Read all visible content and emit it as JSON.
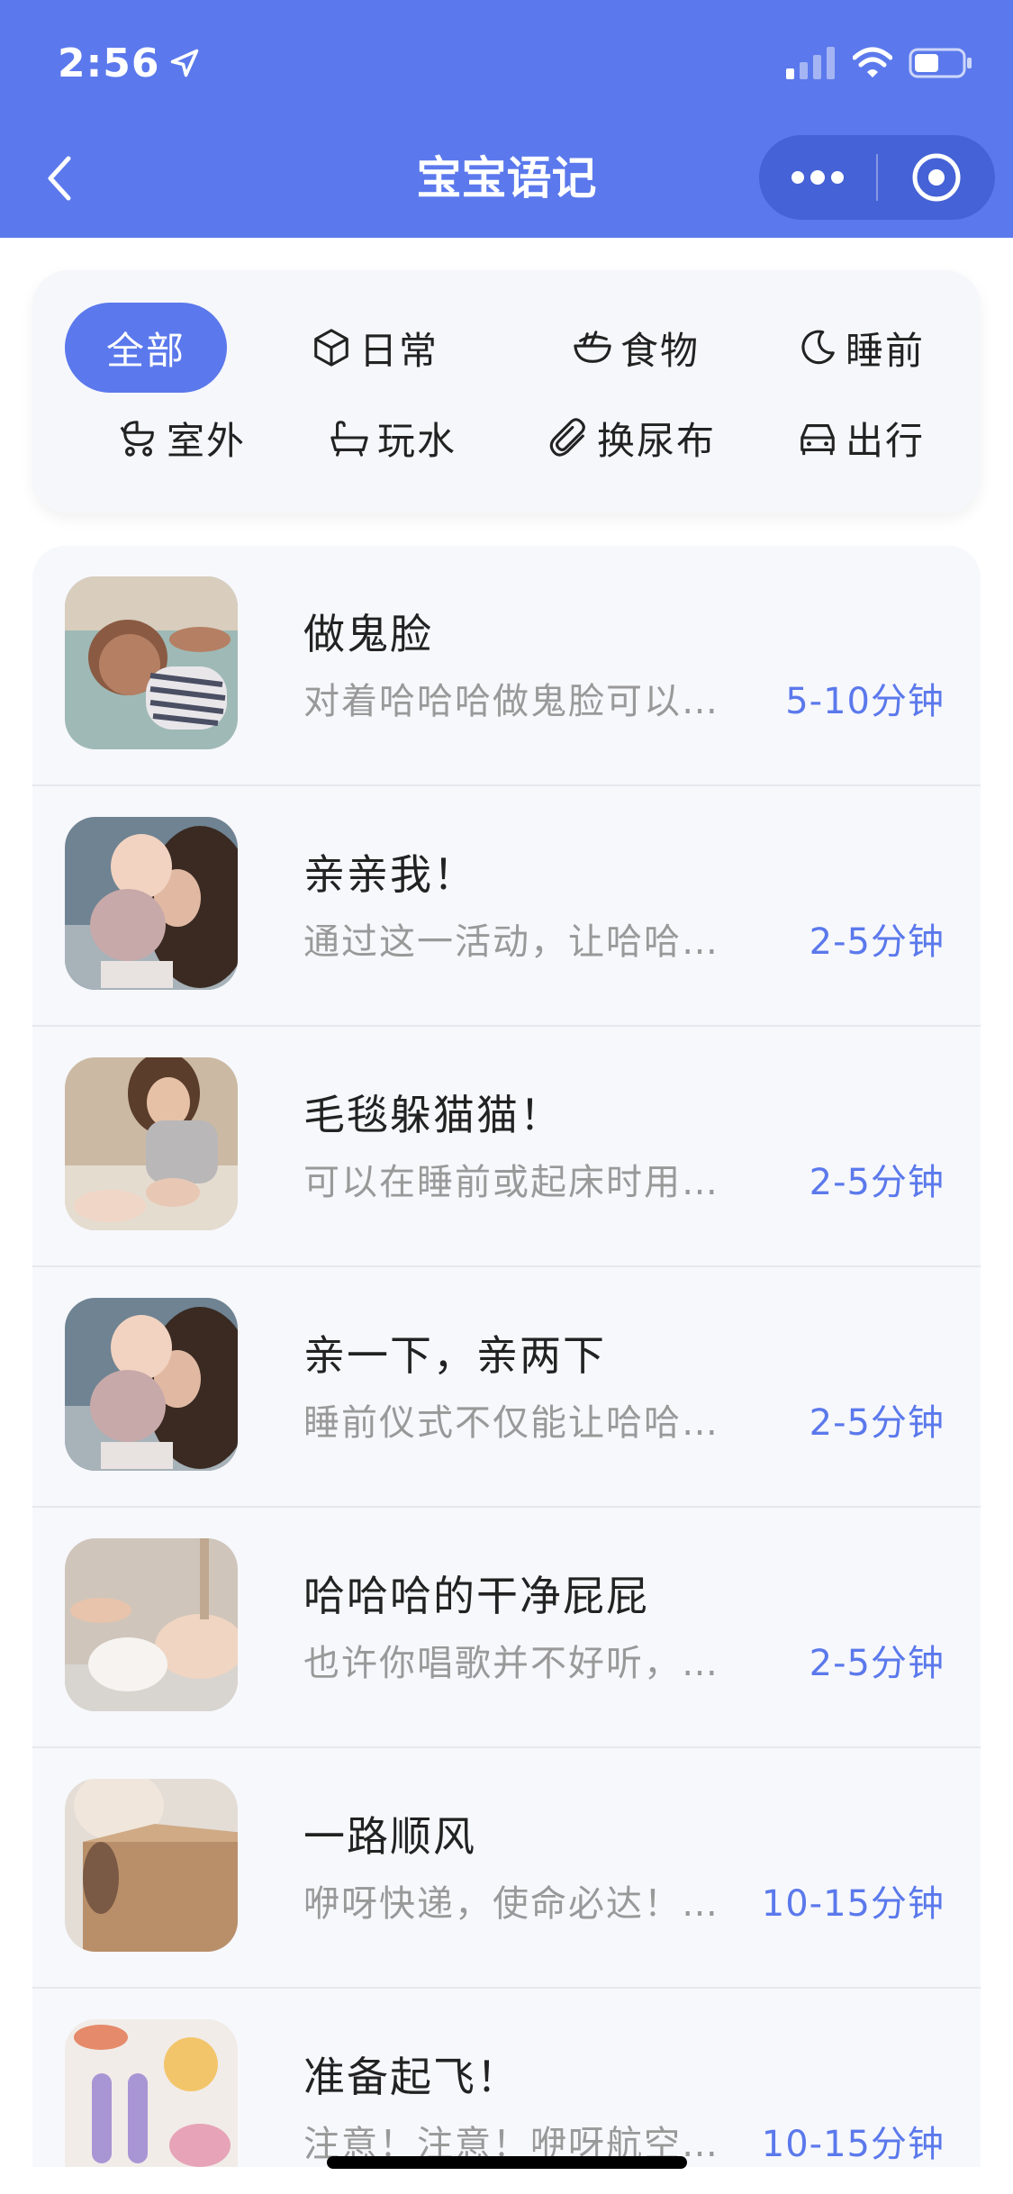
{
  "status_bar": {
    "time": "2:56",
    "location_icon": "location-arrow-icon",
    "signal_icon": "cellular-signal-icon",
    "wifi_icon": "wifi-icon",
    "battery_icon": "battery-icon"
  },
  "nav": {
    "title": "宝宝语记",
    "back_icon": "chevron-left-icon",
    "more_icon": "more-dots-icon",
    "close_icon": "target-circle-icon"
  },
  "colors": {
    "accent": "#5b79ec",
    "capsule": "#4562d6",
    "text": "#222222",
    "subtext": "#999999"
  },
  "filters": [
    {
      "label": "全部",
      "icon": "",
      "active": true
    },
    {
      "label": "日常",
      "icon": "cube-icon",
      "active": false
    },
    {
      "label": "食物",
      "icon": "bowl-icon",
      "active": false
    },
    {
      "label": "睡前",
      "icon": "moon-icon",
      "active": false
    },
    {
      "label": "室外",
      "icon": "stroller-icon",
      "active": false
    },
    {
      "label": "玩水",
      "icon": "bathtub-icon",
      "active": false
    },
    {
      "label": "换尿布",
      "icon": "paperclip-icon",
      "active": false
    },
    {
      "label": "出行",
      "icon": "car-icon",
      "active": false
    }
  ],
  "activities": [
    {
      "title": "做鬼脸",
      "desc": "对着哈哈哈做鬼脸可以…",
      "time": "5-10分钟"
    },
    {
      "title": "亲亲我！",
      "desc": "通过这一活动，让哈哈…",
      "time": "2-5分钟"
    },
    {
      "title": "毛毯躲猫猫！",
      "desc": "可以在睡前或起床时用…",
      "time": "2-5分钟"
    },
    {
      "title": "亲一下，亲两下",
      "desc": "睡前仪式不仅能让哈哈…",
      "time": "2-5分钟"
    },
    {
      "title": "哈哈哈的干净屁屁",
      "desc": "也许你唱歌并不好听，…",
      "time": "2-5分钟"
    },
    {
      "title": "一路顺风",
      "desc": "咿呀快递，使命必达！…",
      "time": "10-15分钟"
    },
    {
      "title": "准备起飞！",
      "desc": "注意！注意！咿呀航空…",
      "time": "10-15分钟"
    }
  ]
}
